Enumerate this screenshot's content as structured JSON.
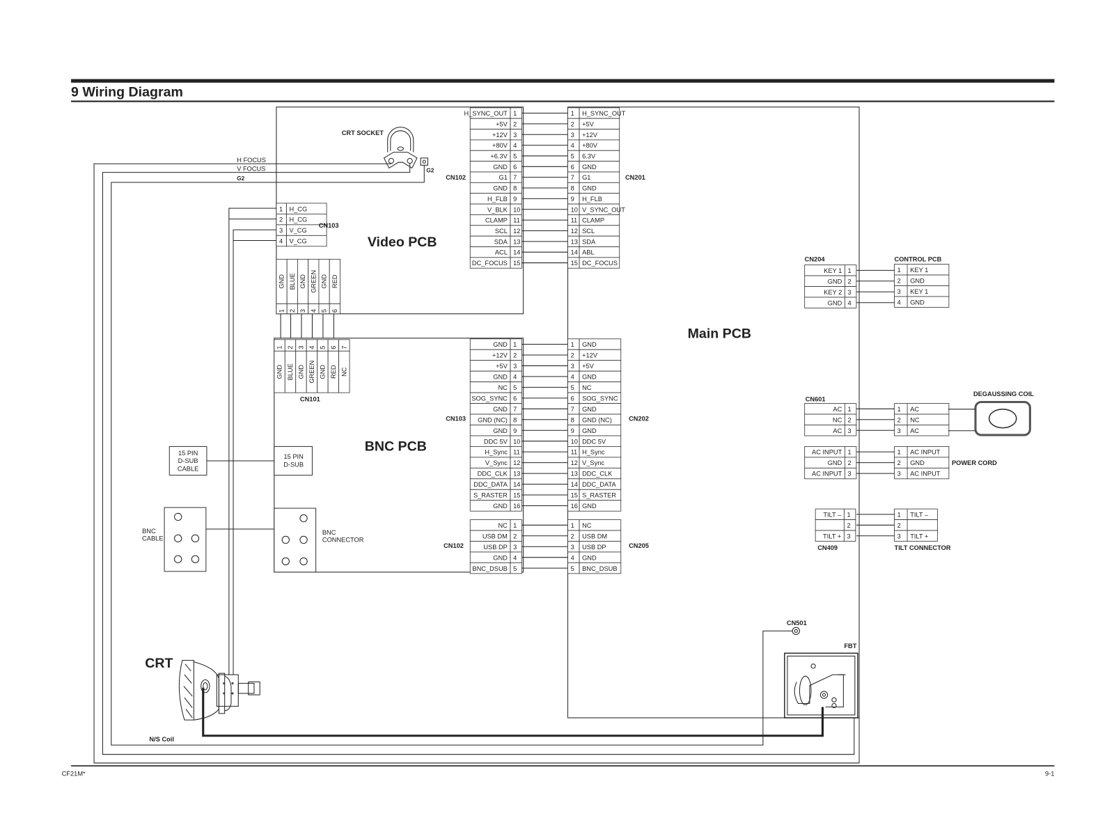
{
  "page": {
    "title": "9 Wiring Diagram",
    "footer_left": "CF21M*",
    "footer_right": "9-1"
  },
  "boards": {
    "video_pcb": "Video PCB",
    "main_pcb": "Main PCB",
    "bnc_pcb": "BNC PCB",
    "crt": "CRT",
    "ns_coil": "N/S Coil",
    "crt_socket": "CRT SOCKET",
    "control_pcb": "CONTROL PCB",
    "degaussing_coil": "DEGAUSSING COIL",
    "power_cord": "POWER CORD",
    "tilt_connector": "TILT CONNECTOR",
    "fbt": "FBT",
    "cn501": "CN501",
    "d_sub_cable": [
      "15 PIN",
      "D-SUB",
      "CABLE"
    ],
    "d_sub": [
      "15 PIN",
      "D-SUB"
    ],
    "bnc_cable": [
      "BNC",
      "CABLE"
    ],
    "bnc_connector": [
      "BNC",
      "CONNECTOR"
    ]
  },
  "crt_wires": {
    "h_focus": "H FOCUS",
    "v_focus": "V FOCUS",
    "g2": "G2",
    "g2_terminal": "G2"
  },
  "connectors": {
    "cn102_video": {
      "name": "CN102",
      "pins": [
        "H_SYNC_OUT",
        "+5V",
        "+12V",
        "+80V",
        "+6.3V",
        "GND",
        "G1",
        "GND",
        "H_FLB",
        "V_BLK",
        "CLAMP",
        "SCL",
        "SDA",
        "ACL",
        "DC_FOCUS"
      ]
    },
    "cn201": {
      "name": "CN201",
      "pins": [
        "H_SYNC_OUT",
        "+5V",
        "+12V",
        "+80V",
        "6.3V",
        "GND",
        "G1",
        "GND",
        "H_FLB",
        "V_SYNC_OUT",
        "CLAMP",
        "SCL",
        "SDA",
        "ABL",
        "DC_FOCUS"
      ]
    },
    "cn103_video": {
      "name": "CN103",
      "pins": [
        "H_CG",
        "H_CG",
        "V_CG",
        "V_CG"
      ]
    },
    "video_rgb": {
      "pins": [
        "GND",
        "BLUE",
        "GND",
        "GREEN",
        "GND",
        "RED"
      ]
    },
    "cn101": {
      "name": "CN101",
      "pins": [
        "GND",
        "BLUE",
        "GND",
        "GREEN",
        "GND",
        "RED",
        "NC"
      ]
    },
    "cn103_bnc": {
      "name": "CN103",
      "pins": [
        "GND",
        "+12V",
        "+5V",
        "GND",
        "NC",
        "SOG_SYNC",
        "GND",
        "GND (NC)",
        "GND",
        "DDC 5V",
        "H_Sync",
        "V_Sync",
        "DDC_CLK",
        "DDC_DATA",
        "S_RASTER",
        "GND"
      ]
    },
    "cn202": {
      "name": "CN202",
      "pins": [
        "GND",
        "+12V",
        "+5V",
        "GND",
        "NC",
        "SOG_SYNC",
        "GND",
        "GND (NC)",
        "GND",
        "DDC 5V",
        "H_Sync",
        "V_Sync",
        "DDC_CLK",
        "DDC_DATA",
        "S_RASTER",
        "GND"
      ]
    },
    "cn102_bnc": {
      "name": "CN102",
      "pins": [
        "NC",
        "USB DM",
        "USB DP",
        "GND",
        "BNC_DSUB"
      ]
    },
    "cn205": {
      "name": "CN205",
      "pins": [
        "NC",
        "USB DM",
        "USB DP",
        "GND",
        "BNC_DSUB"
      ]
    },
    "cn204": {
      "name": "CN204",
      "pins": [
        "KEY 1",
        "GND",
        "KEY 2",
        "GND"
      ]
    },
    "control": {
      "pins": [
        "KEY 1",
        "GND",
        "KEY 1",
        "GND"
      ]
    },
    "cn601": {
      "name": "CN601",
      "pins": [
        "AC",
        "NC",
        "AC"
      ]
    },
    "degauss": {
      "pins": [
        "AC",
        "NC",
        "AC"
      ]
    },
    "power_main": {
      "pins": [
        "AC INPUT",
        "GND",
        "AC INPUT"
      ]
    },
    "power_cord": {
      "pins": [
        "AC INPUT",
        "GND",
        "AC INPUT"
      ]
    },
    "cn409": {
      "name": "CN409",
      "pins": [
        "TILT –",
        "",
        "TILT +"
      ]
    },
    "tilt": {
      "pins": [
        "TILT –",
        "",
        "TILT +"
      ]
    }
  }
}
